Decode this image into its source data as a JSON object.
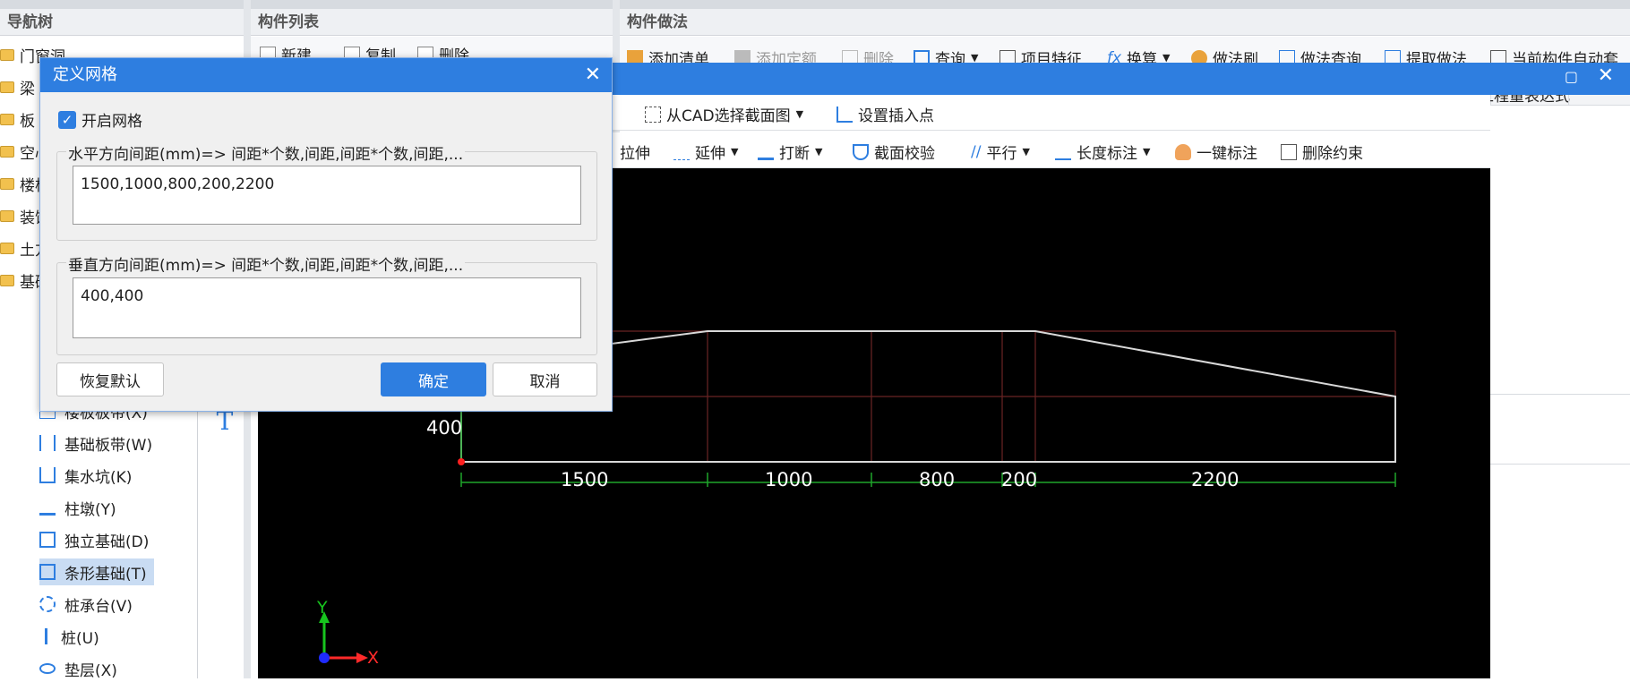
{
  "panels": {
    "nav_title": "导航树",
    "list_title": "构件列表",
    "method_title": "构件做法"
  },
  "nav_tree": {
    "top_items": [
      "门窗洞",
      "梁",
      "板",
      "空心",
      "楼梯",
      "装饰",
      "土方",
      "基础"
    ],
    "items": [
      {
        "label": "楼板板带(X)",
        "icon": "slab-strip-icon"
      },
      {
        "label": "基础板带(W)",
        "icon": "foundation-strip-icon"
      },
      {
        "label": "集水坑(K)",
        "icon": "sump-pit-icon"
      },
      {
        "label": "柱墩(Y)",
        "icon": "column-pier-icon"
      },
      {
        "label": "独立基础(D)",
        "icon": "isolated-footing-icon"
      },
      {
        "label": "条形基础(T)",
        "icon": "strip-footing-icon"
      },
      {
        "label": "桩承台(V)",
        "icon": "pile-cap-icon"
      },
      {
        "label": "桩(U)",
        "icon": "pile-icon"
      },
      {
        "label": "垫层(X)",
        "icon": "cushion-icon"
      }
    ]
  },
  "list_toolbar": {
    "new": "新建",
    "copy": "复制",
    "delete": "删除"
  },
  "method_toolbar": {
    "add_list": "添加清单",
    "add_quota": "添加定额",
    "delete": "删除",
    "query": "查询",
    "project_feature": "项目特征",
    "calc": "换算",
    "method_brush": "做法刷",
    "method_query": "做法查询",
    "extract_method": "提取做法",
    "auto_apply": "当前构件自动套"
  },
  "method_table": {
    "expression_header": "工程量表达式"
  },
  "editor_toolbar": {
    "row1": {
      "cad_select": "从CAD选择截面图",
      "set_insert": "设置插入点"
    },
    "row2": {
      "stretch": "拉伸",
      "extend": "延伸",
      "break": "打断",
      "check": "截面校验",
      "parallel": "平行",
      "length_dim": "长度标注",
      "one_key_dim": "一键标注",
      "delete_constraint": "删除约束"
    }
  },
  "canvas": {
    "dims": [
      "1500",
      "1000",
      "800",
      "200",
      "2200"
    ],
    "v_dim": "400",
    "axis_x": "X",
    "axis_y": "Y"
  },
  "dialog": {
    "title": "定义网格",
    "enable_grid": "开启网格",
    "h_legend": "水平方向间距(mm)=> 间距*个数,间距,间距*个数,间距,...",
    "h_value": "1500,1000,800,200,2200",
    "v_legend": "垂直方向间距(mm)=> 间距*个数,间距,间距*个数,间距,...",
    "v_value": "400,400",
    "restore": "恢复默认",
    "ok": "确定",
    "cancel": "取消"
  }
}
